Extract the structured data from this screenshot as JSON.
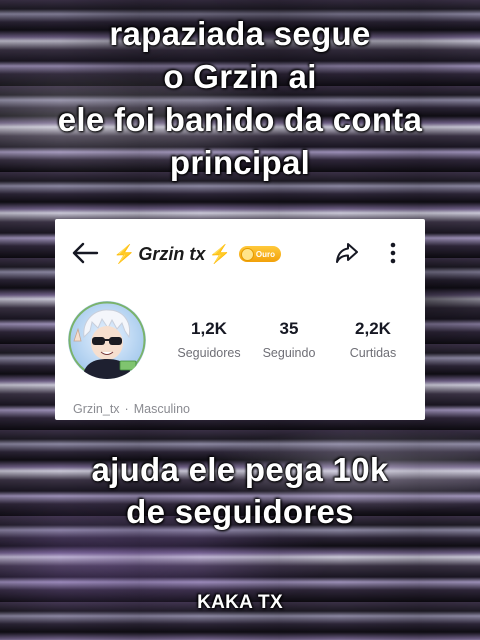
{
  "overlay": {
    "top_lines": [
      "rapaziada segue",
      "o Grzin ai",
      "ele foi banido da conta",
      "principal"
    ],
    "middle_lines": [
      "ajuda ele pega 10k",
      "de seguidores"
    ],
    "watermark": "KAKA TX"
  },
  "profile": {
    "name": "Grzin tx",
    "bolt": "⚡",
    "badge_label": "Ouro",
    "stats": [
      {
        "value": "1,2K",
        "label": "Seguidores"
      },
      {
        "value": "35",
        "label": "Seguindo"
      },
      {
        "value": "2,2K",
        "label": "Curtidas"
      }
    ],
    "username": "Grzin_tx",
    "separator": "·",
    "gender": "Masculino"
  },
  "colors": {
    "accent_gold": "#f6b90b",
    "text_dark": "#161823",
    "text_muted": "#6f6f76"
  },
  "icons": [
    "back-arrow-icon",
    "lightning-icon",
    "coin-icon",
    "share-icon",
    "more-vertical-icon"
  ]
}
